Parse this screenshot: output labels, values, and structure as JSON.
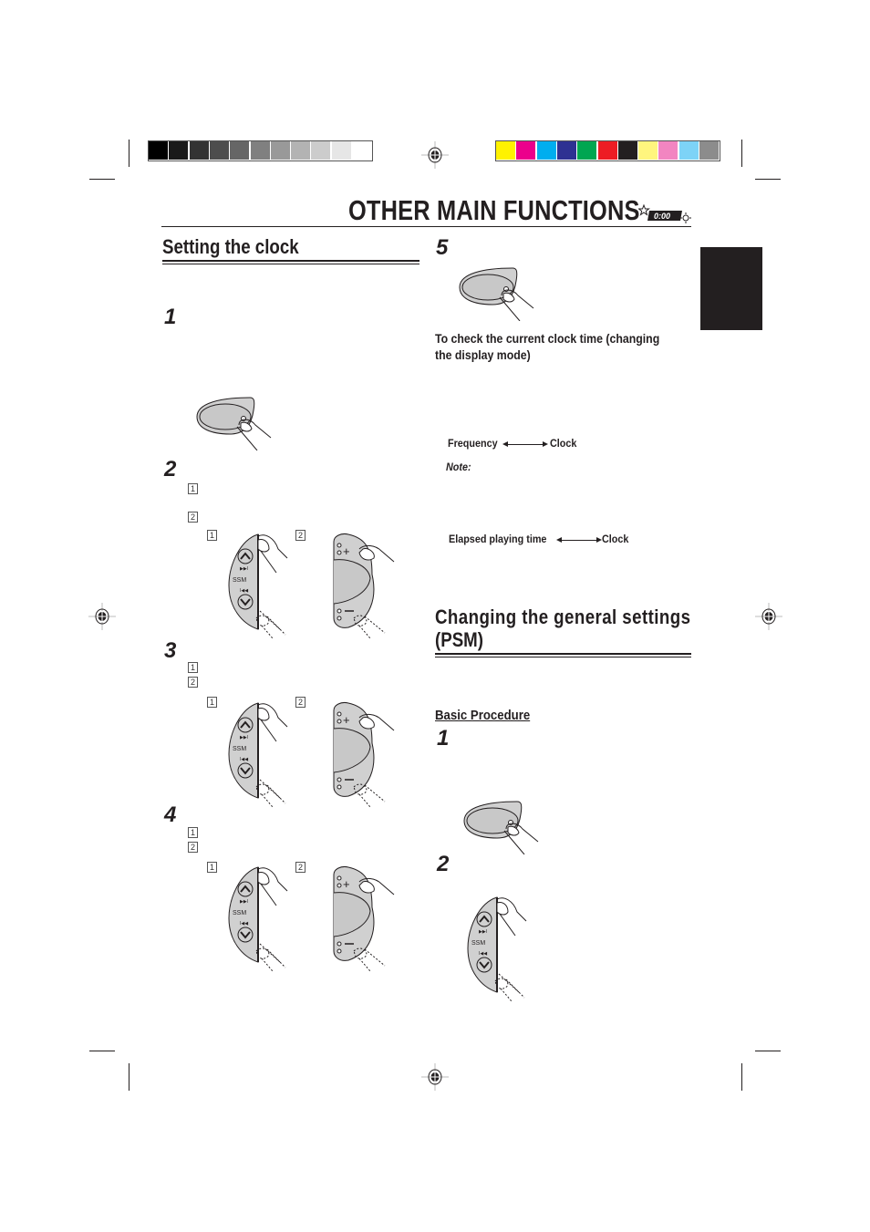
{
  "color_bar": {
    "grayscale": [
      "#000000",
      "#1a1a1a",
      "#333333",
      "#4d4d4d",
      "#666666",
      "#808080",
      "#999999",
      "#b3b3b3",
      "#cccccc",
      "#e6e6e6",
      "#ffffff"
    ],
    "colors": [
      "#fff200",
      "#ec008c",
      "#00aeef",
      "#2e3192",
      "#00a651",
      "#ed1c24",
      "#231f20",
      "#fff57e",
      "#f285c1",
      "#7dd3f7",
      "#8c8c8c"
    ]
  },
  "page": {
    "title": "OTHER MAIN FUNCTIONS",
    "title_icon": "0:00",
    "side_tab_color": "#231f20"
  },
  "left": {
    "heading": "Setting the clock",
    "steps": [
      {
        "num": "1"
      },
      {
        "num": "2",
        "subs": [
          "1",
          "2"
        ],
        "fig_labels": [
          "1",
          "2"
        ]
      },
      {
        "num": "3",
        "subs": [
          "1",
          "2"
        ],
        "fig_labels": [
          "1",
          "2"
        ]
      },
      {
        "num": "4",
        "subs": [
          "1",
          "2"
        ],
        "fig_labels": [
          "1",
          "2"
        ]
      }
    ],
    "ssm_label": "SSM"
  },
  "right": {
    "step5": "5",
    "check_heading_line1": "To check the current clock time (changing",
    "check_heading_line2": "the display mode)",
    "mode1_from": "Frequency",
    "mode1_to": "Clock",
    "note_label": "Note:",
    "mode2_from": "Elapsed playing time",
    "mode2_to": "Clock",
    "psm_heading_line1": "Changing  the  general  settings",
    "psm_heading_line2": "(PSM)",
    "basic_procedure": "Basic Procedure",
    "psm_steps": [
      "1",
      "2"
    ],
    "ssm_label": "SSM"
  }
}
